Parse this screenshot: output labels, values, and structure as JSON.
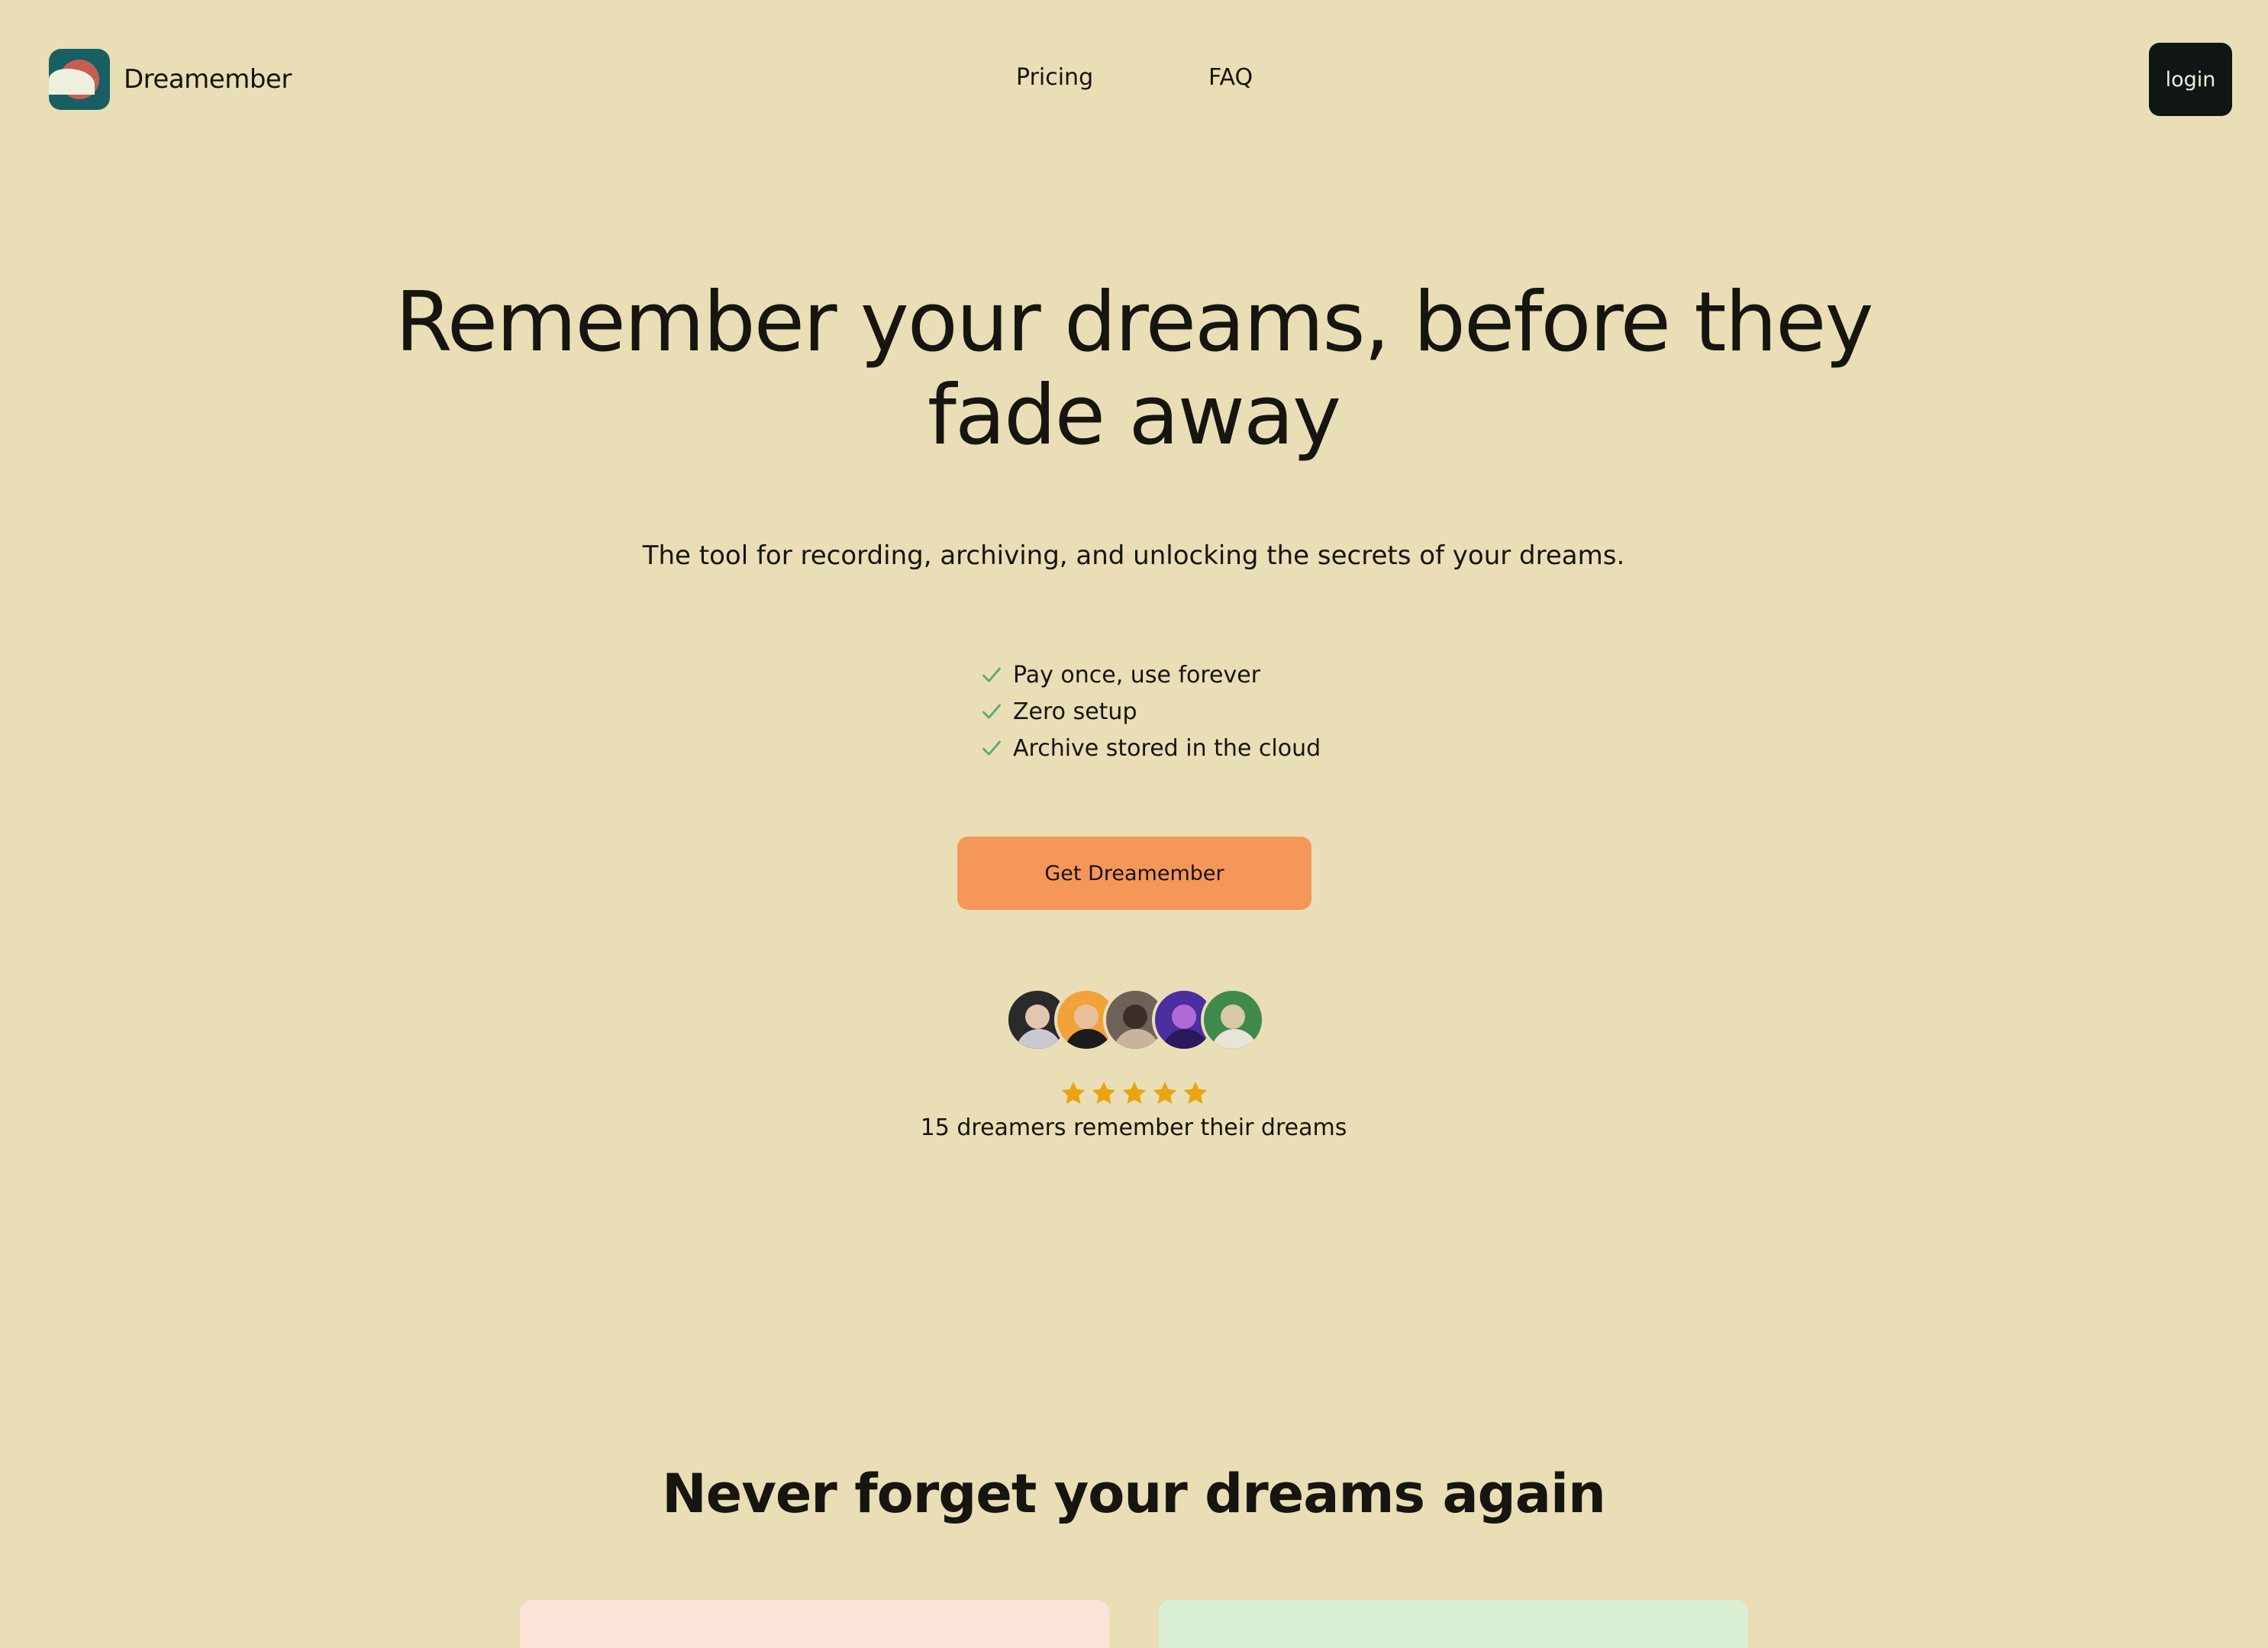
{
  "header": {
    "brand": "Dreamember",
    "nav": [
      "Pricing",
      "FAQ"
    ],
    "login_label": "login"
  },
  "hero": {
    "title": "Remember your dreams, before they fade away",
    "subtitle": "The tool for recording, archiving, and unlocking the secrets of your dreams.",
    "features": [
      "Pay once, use forever",
      "Zero setup",
      "Archive stored in the cloud"
    ],
    "cta_label": "Get Dreamember",
    "rating": 5,
    "rating_text": "15 dreamers remember their dreams"
  },
  "section2": {
    "title": "Never forget your dreams again"
  },
  "colors": {
    "background": "#e9deb6",
    "cta": "#f59759",
    "login_bg": "#0f1613",
    "logo_bg": "#185f63",
    "check": "#5aa87a",
    "star": "#e9a40f",
    "card_left": "#fbe3d9",
    "card_right": "#d9f0d5"
  },
  "icons": {
    "logo": "moon-cloud-logo-icon",
    "feature_bullet": "check-icon",
    "rating": "star-icon"
  }
}
